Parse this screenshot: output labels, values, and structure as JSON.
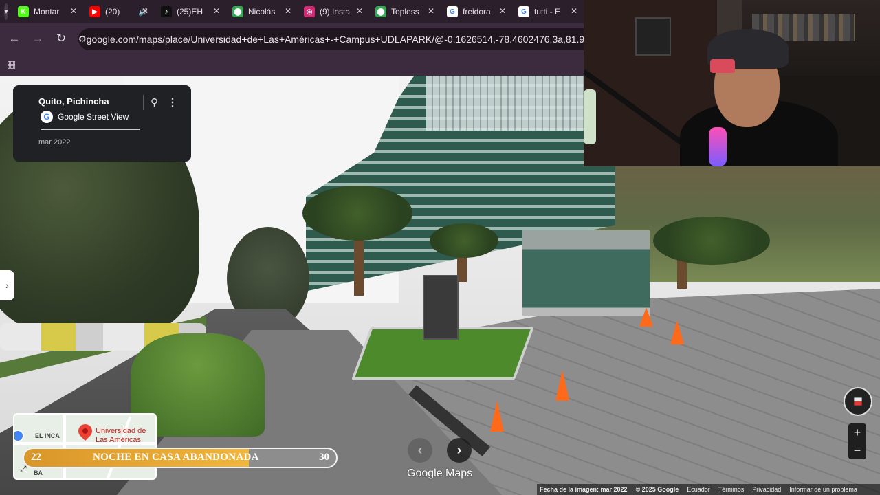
{
  "browser": {
    "tabs": [
      {
        "title": "Montar",
        "icon": "kick-icon",
        "icon_color": "#53fc18",
        "glyph": "K"
      },
      {
        "title": "(20)",
        "icon": "youtube-icon",
        "icon_color": "#ff0000",
        "glyph": "▶",
        "extra": "🔊"
      },
      {
        "title": "(25)EH",
        "icon": "tiktok-icon",
        "icon_color": "#111111",
        "glyph": "♪"
      },
      {
        "title": "Nicolás",
        "icon": "maps-icon",
        "icon_color": "#34a853",
        "glyph": "⬤"
      },
      {
        "title": "(9) Insta",
        "icon": "instagram-icon",
        "icon_color": "#d62976",
        "glyph": "◎"
      },
      {
        "title": "Topless",
        "icon": "maps-icon",
        "icon_color": "#34a853",
        "glyph": "⬤"
      },
      {
        "title": "freidora",
        "icon": "google-icon",
        "icon_color": "#ffffff",
        "glyph": "G"
      },
      {
        "title": "tutti - E",
        "icon": "google-icon",
        "icon_color": "#ffffff",
        "glyph": "G"
      }
    ],
    "url": "google.com/maps/place/Universidad+de+Las+Américas+-+Campus+UDLAPARK/@-0.1626514,-78.4602476,3a,81.9y,132"
  },
  "streetview": {
    "location": "Quito, Pichincha",
    "brand": "Google Street View",
    "date": "mar 2022"
  },
  "minimap": {
    "place_line1": "Universidad de",
    "place_line2": "Las Américas",
    "label_inca": "EL INCA",
    "label_ba": "BA"
  },
  "banner": {
    "left_number": "22",
    "title": "NOCHE EN CASA ABANDONADA",
    "right_number": "30",
    "progress": 0.72
  },
  "branding": {
    "logo": "Google Maps"
  },
  "footer": {
    "image_date": "Fecha de la imagen: mar 2022",
    "copyright": "© 2025 Google",
    "links": [
      "Ecuador",
      "Términos",
      "Privacidad",
      "Informar de un problema"
    ]
  },
  "colors": {
    "browser_bg": "#3c2b3e",
    "banner_fill": "#f0b63c",
    "map_pin": "#ea4335"
  }
}
